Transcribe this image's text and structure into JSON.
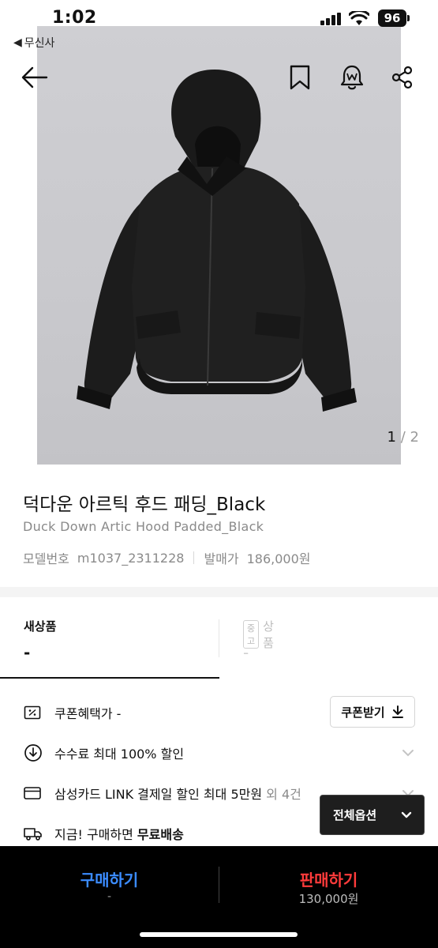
{
  "status_bar": {
    "time": "1:02",
    "battery": "96",
    "back_app": "무신사"
  },
  "header": {
    "icons": [
      "back-arrow-icon",
      "bookmark-icon",
      "alert-bell-icon",
      "share-icon"
    ]
  },
  "gallery": {
    "current": "1",
    "separator": "/",
    "total": "2"
  },
  "product": {
    "name_ko": "덕다운 아르틱 후드 패딩_Black",
    "name_en": "Duck Down Artic Hood Padded_Black",
    "model_label": "모델번호",
    "model_value": "m1037_2311228",
    "release_price_label": "발매가",
    "release_price_value": "186,000원"
  },
  "tabs": {
    "new": {
      "label": "새상품",
      "value": "-"
    },
    "used": {
      "badge": "중고",
      "label": "상품",
      "value": "-"
    }
  },
  "benefits": {
    "coupon_price": "쿠폰혜택가 -",
    "coupon_button": "쿠폰받기",
    "fee_discount": "수수료 최대 100% 할인",
    "card_prefix": "삼성카드 LINK 결제일 할인 최대 5만원",
    "card_suffix": " 외 4건",
    "shipping_prefix": "지금! 구매하면 ",
    "shipping_bold": "무료배송"
  },
  "all_options": {
    "label": "전체옵션"
  },
  "bottom_bar": {
    "buy_label": "구매하기",
    "buy_price": "-",
    "sell_label": "판매하기",
    "sell_price": "130,000원"
  },
  "colors": {
    "buy": "#3b8cff",
    "sell": "#ff3b3b",
    "background_bottom": "#000000"
  }
}
